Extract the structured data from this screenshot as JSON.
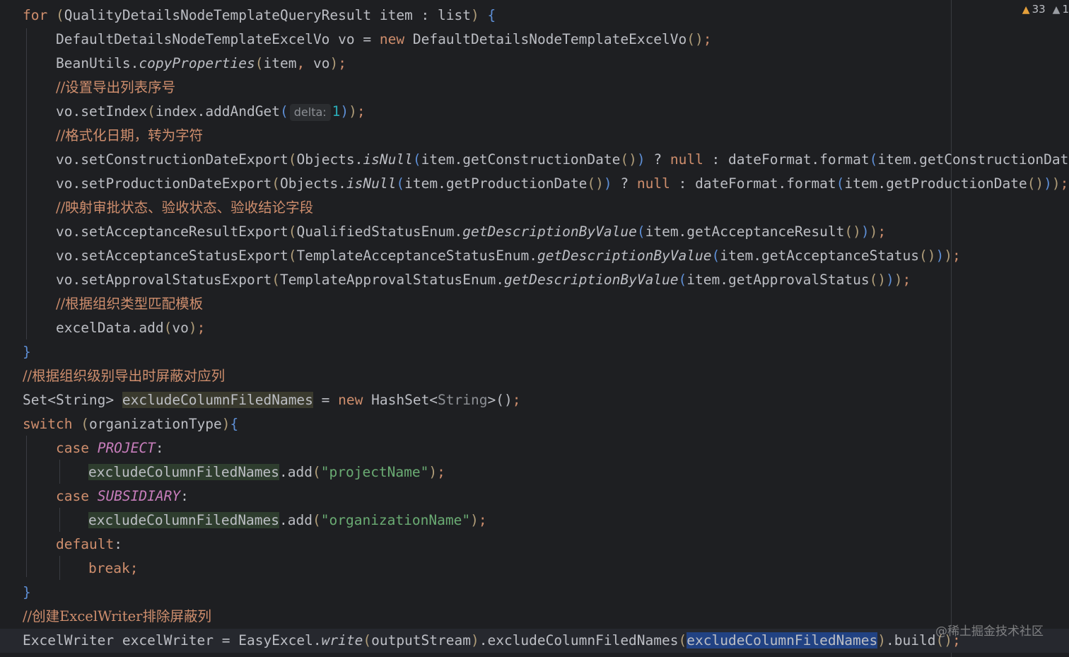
{
  "status": {
    "warnings": "33",
    "weak_warnings": "1"
  },
  "watermark": "@稀土掘金技术社区",
  "lines": [
    [
      {
        "c": "kw",
        "t": "for "
      },
      {
        "c": "pg",
        "t": "("
      },
      {
        "c": "ty",
        "t": "QualityDetailsNodeTemplateQueryResult item : list"
      },
      {
        "c": "pg",
        "t": ")"
      },
      {
        "c": "pu",
        "t": " "
      },
      {
        "c": "pb",
        "t": "{"
      }
    ],
    [
      {
        "c": "ty",
        "t": "DefaultDetailsNodeTemplateExcelVo vo = "
      },
      {
        "c": "kw",
        "t": "new "
      },
      {
        "c": "ty",
        "t": "DefaultDetailsNodeTemplateExcelVo"
      },
      {
        "c": "pg",
        "t": "()"
      },
      {
        "c": "kw",
        "t": ";"
      }
    ],
    [
      {
        "c": "ty",
        "t": "BeanUtils."
      },
      {
        "c": "ty it",
        "t": "copyProperties"
      },
      {
        "c": "pg",
        "t": "("
      },
      {
        "c": "ty",
        "t": "item"
      },
      {
        "c": "kw",
        "t": ", "
      },
      {
        "c": "ty",
        "t": "vo"
      },
      {
        "c": "pg",
        "t": ")"
      },
      {
        "c": "kw",
        "t": ";"
      }
    ],
    [
      {
        "c": "comment-cn",
        "t": "//设置导出列表序号"
      }
    ],
    [
      {
        "c": "ty",
        "t": "vo.setIndex"
      },
      {
        "c": "pg",
        "t": "("
      },
      {
        "c": "ty",
        "t": "index.addAndGet"
      },
      {
        "c": "pb",
        "t": "("
      },
      {
        "c": "hint",
        "t": "delta:"
      },
      {
        "c": "num",
        "t": "1"
      },
      {
        "c": "pb",
        "t": ")"
      },
      {
        "c": "pg",
        "t": ")"
      },
      {
        "c": "kw",
        "t": ";"
      }
    ],
    [
      {
        "c": "comment-cn",
        "t": "//格式化日期，转为字符"
      }
    ],
    [
      {
        "c": "ty",
        "t": "vo.setConstructionDateExport"
      },
      {
        "c": "pg",
        "t": "("
      },
      {
        "c": "ty",
        "t": "Objects."
      },
      {
        "c": "ty it",
        "t": "isNull"
      },
      {
        "c": "pb",
        "t": "("
      },
      {
        "c": "ty",
        "t": "item.getConstructionDate"
      },
      {
        "c": "pg",
        "t": "()"
      },
      {
        "c": "pb",
        "t": ")"
      },
      {
        "c": "ty",
        "t": " ? "
      },
      {
        "c": "kw",
        "t": "null"
      },
      {
        "c": "ty",
        "t": " : dateFormat.format"
      },
      {
        "c": "pb",
        "t": "("
      },
      {
        "c": "ty",
        "t": "item.getConstructionDate"
      }
    ],
    [
      {
        "c": "ty",
        "t": "vo.setProductionDateExport"
      },
      {
        "c": "pg",
        "t": "("
      },
      {
        "c": "ty",
        "t": "Objects."
      },
      {
        "c": "ty it",
        "t": "isNull"
      },
      {
        "c": "pb",
        "t": "("
      },
      {
        "c": "ty",
        "t": "item.getProductionDate"
      },
      {
        "c": "pg",
        "t": "()"
      },
      {
        "c": "pb",
        "t": ")"
      },
      {
        "c": "ty",
        "t": " ? "
      },
      {
        "c": "kw",
        "t": "null"
      },
      {
        "c": "ty",
        "t": " : dateFormat.format"
      },
      {
        "c": "pb",
        "t": "("
      },
      {
        "c": "ty",
        "t": "item.getProductionDate"
      },
      {
        "c": "pg",
        "t": "()"
      },
      {
        "c": "pb",
        "t": ")"
      },
      {
        "c": "pg",
        "t": ")"
      },
      {
        "c": "kw",
        "t": ";"
      }
    ],
    [
      {
        "c": "comment-cn",
        "t": "//映射审批状态、验收状态、验收结论字段"
      }
    ],
    [
      {
        "c": "ty",
        "t": "vo.setAcceptanceResultExport"
      },
      {
        "c": "pg",
        "t": "("
      },
      {
        "c": "ty",
        "t": "QualifiedStatusEnum."
      },
      {
        "c": "ty it",
        "t": "getDescriptionByValue"
      },
      {
        "c": "pb",
        "t": "("
      },
      {
        "c": "ty",
        "t": "item.getAcceptanceResult"
      },
      {
        "c": "pg",
        "t": "()"
      },
      {
        "c": "pb",
        "t": ")"
      },
      {
        "c": "pg",
        "t": ")"
      },
      {
        "c": "kw",
        "t": ";"
      }
    ],
    [
      {
        "c": "ty",
        "t": "vo.setAcceptanceStatusExport"
      },
      {
        "c": "pg",
        "t": "("
      },
      {
        "c": "ty",
        "t": "TemplateAcceptanceStatusEnum."
      },
      {
        "c": "ty it",
        "t": "getDescriptionByValue"
      },
      {
        "c": "pb",
        "t": "("
      },
      {
        "c": "ty",
        "t": "item.getAcceptanceStatus"
      },
      {
        "c": "pg",
        "t": "()"
      },
      {
        "c": "pb",
        "t": ")"
      },
      {
        "c": "pg",
        "t": ")"
      },
      {
        "c": "kw",
        "t": ";"
      }
    ],
    [
      {
        "c": "ty",
        "t": "vo.setApprovalStatusExport"
      },
      {
        "c": "pg",
        "t": "("
      },
      {
        "c": "ty",
        "t": "TemplateApprovalStatusEnum."
      },
      {
        "c": "ty it",
        "t": "getDescriptionByValue"
      },
      {
        "c": "pb",
        "t": "("
      },
      {
        "c": "ty",
        "t": "item.getApprovalStatus"
      },
      {
        "c": "pg",
        "t": "()"
      },
      {
        "c": "pb",
        "t": ")"
      },
      {
        "c": "pg",
        "t": ")"
      },
      {
        "c": "kw",
        "t": ";"
      }
    ],
    [
      {
        "c": "comment-cn",
        "t": "//根据组织类型匹配模板"
      }
    ],
    [
      {
        "c": "ty",
        "t": "excelData.add"
      },
      {
        "c": "pg",
        "t": "("
      },
      {
        "c": "ty",
        "t": "vo"
      },
      {
        "c": "pg",
        "t": ")"
      },
      {
        "c": "kw",
        "t": ";"
      }
    ],
    [
      {
        "c": "pb",
        "t": "}"
      }
    ],
    [
      {
        "c": "comment-cn",
        "t": "//根据组织级别导出时屏蔽对应列"
      }
    ],
    [
      {
        "c": "ty",
        "t": "Set<String> "
      },
      {
        "c": "ty hl-var",
        "t": "excludeColumnFiledNames"
      },
      {
        "c": "ty",
        "t": " = "
      },
      {
        "c": "kw",
        "t": "new "
      },
      {
        "c": "ty",
        "t": "HashSet<"
      },
      {
        "c": "gray",
        "t": "String"
      },
      {
        "c": "ty",
        "t": ">()"
      },
      {
        "c": "kw",
        "t": ";"
      }
    ],
    [
      {
        "c": "kw",
        "t": "switch "
      },
      {
        "c": "pg",
        "t": "("
      },
      {
        "c": "ty",
        "t": "organizationType"
      },
      {
        "c": "pg",
        "t": ")"
      },
      {
        "c": "pb",
        "t": "{"
      }
    ],
    [
      {
        "c": "kw",
        "t": "case "
      },
      {
        "c": "cst",
        "t": "PROJECT"
      },
      {
        "c": "ty",
        "t": ":"
      }
    ],
    [
      {
        "c": "ty hl-wr",
        "t": "excludeColumnFiledNames"
      },
      {
        "c": "ty",
        "t": ".add"
      },
      {
        "c": "pg",
        "t": "("
      },
      {
        "c": "str",
        "t": "\"projectName\""
      },
      {
        "c": "pg",
        "t": ")"
      },
      {
        "c": "kw",
        "t": ";"
      }
    ],
    [
      {
        "c": "kw",
        "t": "case "
      },
      {
        "c": "cst",
        "t": "SUBSIDIARY"
      },
      {
        "c": "ty",
        "t": ":"
      }
    ],
    [
      {
        "c": "ty hl-wr",
        "t": "excludeColumnFiledNames"
      },
      {
        "c": "ty",
        "t": ".add"
      },
      {
        "c": "pg",
        "t": "("
      },
      {
        "c": "str",
        "t": "\"organizationName\""
      },
      {
        "c": "pg",
        "t": ")"
      },
      {
        "c": "kw",
        "t": ";"
      }
    ],
    [
      {
        "c": "kw",
        "t": "default"
      },
      {
        "c": "ty",
        "t": ":"
      }
    ],
    [
      {
        "c": "kw",
        "t": "break;"
      }
    ],
    [
      {
        "c": "pb",
        "t": "}"
      }
    ],
    [
      {
        "c": "comment-cn",
        "t": "//创建ExcelWriter排除屏蔽列"
      }
    ],
    [
      {
        "c": "ty",
        "t": "ExcelWriter excelWriter = EasyExcel."
      },
      {
        "c": "ty it",
        "t": "write"
      },
      {
        "c": "pg",
        "t": "("
      },
      {
        "c": "ty",
        "t": "outputStream"
      },
      {
        "c": "pg",
        "t": ")"
      },
      {
        "c": "ty",
        "t": ".excludeColumnFiledNames"
      },
      {
        "c": "pg",
        "t": "("
      },
      {
        "c": "ty hl-sel",
        "t": "excludeColumnFiledNames"
      },
      {
        "c": "pg",
        "t": ")"
      },
      {
        "c": "ty",
        "t": ".build"
      },
      {
        "c": "pg",
        "t": "()"
      },
      {
        "c": "kw",
        "t": ";"
      }
    ]
  ]
}
